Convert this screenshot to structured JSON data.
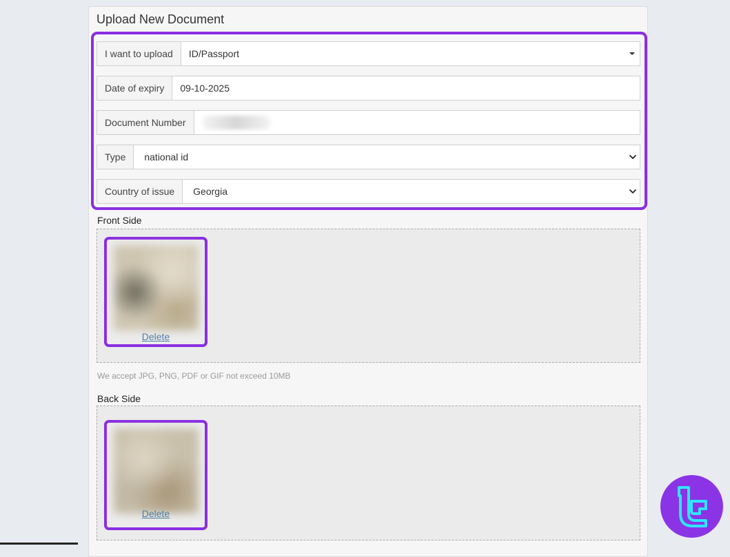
{
  "panel": {
    "title": "Upload New Document"
  },
  "form": {
    "upload_type": {
      "label": "I want to upload",
      "value": "ID/Passport"
    },
    "expiry": {
      "label": "Date of expiry",
      "value": "09-10-2025"
    },
    "doc_number": {
      "label": "Document Number",
      "value": ""
    },
    "type": {
      "label": "Type",
      "value": "national id"
    },
    "country": {
      "label": "Country of issue",
      "value": "Georgia"
    }
  },
  "front": {
    "label": "Front Side",
    "delete_label": "Delete"
  },
  "hint": "We accept JPG, PNG, PDF or GIF not exceed 10MB",
  "back": {
    "label": "Back Side",
    "delete_label": "Delete"
  },
  "colors": {
    "highlight": "#8a2ee3",
    "logo_bg": "#8b34e6",
    "logo_fg": "#2ee6ff"
  }
}
